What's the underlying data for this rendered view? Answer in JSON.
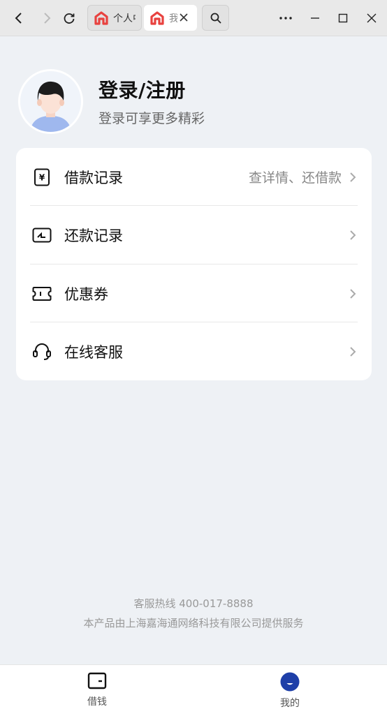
{
  "browser": {
    "tabs": [
      {
        "title": "个人中心",
        "active": false
      },
      {
        "title": "我的",
        "active": true
      }
    ],
    "icons": [
      "back-icon",
      "forward-icon",
      "reload-icon",
      "search-icon",
      "more-icon",
      "minimize-icon",
      "maximize-icon",
      "close-icon"
    ]
  },
  "profile": {
    "title": "登录/注册",
    "subtitle": "登录可享更多精彩"
  },
  "menu": {
    "items": [
      {
        "label": "借款记录",
        "hint": "查详情、还借款",
        "icon": "loan-record-icon"
      },
      {
        "label": "还款记录",
        "hint": "",
        "icon": "repay-record-icon"
      },
      {
        "label": "优惠券",
        "hint": "",
        "icon": "coupon-icon"
      },
      {
        "label": "在线客服",
        "hint": "",
        "icon": "headset-icon"
      }
    ]
  },
  "footer": {
    "hotline": "客服热线 400-017-8888",
    "company": "本产品由上海嘉海通网络科技有限公司提供服务"
  },
  "bottom_nav": {
    "items": [
      {
        "label": "借钱",
        "active": false,
        "icon": "wallet-icon"
      },
      {
        "label": "我的",
        "active": true,
        "icon": "profile-face-icon"
      }
    ]
  },
  "colors": {
    "background": "#eef1f5",
    "brand_tab_icon": "#e8423f",
    "nav_active": "#1e3fa8"
  }
}
